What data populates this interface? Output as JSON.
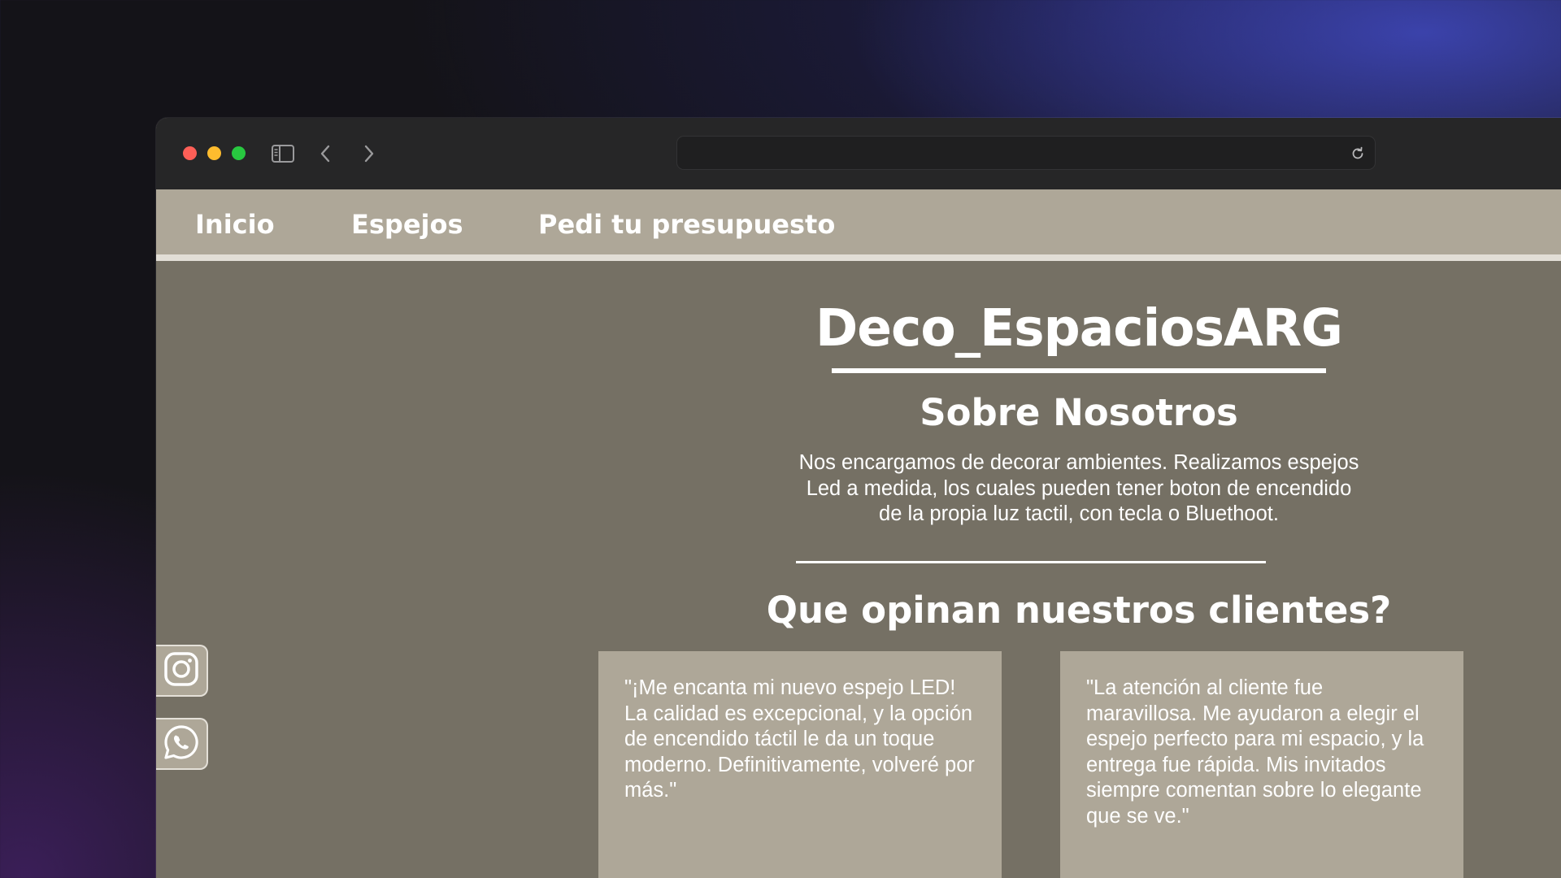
{
  "browser": {
    "url": ""
  },
  "nav": {
    "items": [
      {
        "label": "Inicio"
      },
      {
        "label": "Espejos"
      },
      {
        "label": "Pedi tu presupuesto"
      }
    ]
  },
  "main": {
    "brand": "Deco_EspaciosARG",
    "about_title": "Sobre Nosotros",
    "about_text": "Nos encargamos de decorar ambientes. Realizamos espejos Led a medida, los cuales pueden tener boton de encendido de la propia luz tactil, con tecla o Bluethoot.",
    "reviews_title": "Que opinan nuestros clientes?",
    "reviews": [
      {
        "text": "\"¡Me encanta mi nuevo espejo LED! La calidad es excepcional, y la opción de encendido táctil le da un toque moderno. Definitivamente, volveré por más.\""
      },
      {
        "text": "\"La atención al cliente fue maravillosa. Me ayudaron a elegir el espejo perfecto para mi espacio, y la entrega fue rápida. Mis invitados siempre comentan sobre lo elegante que se ve.\""
      }
    ]
  },
  "social": {
    "items": [
      {
        "icon": "instagram-icon"
      },
      {
        "icon": "whatsapp-icon"
      }
    ]
  },
  "colors": {
    "page_bg": "#757064",
    "nav_bg": "#aea798",
    "card_bg": "#aea798",
    "toolbar_bg": "#262627",
    "accent_text": "#ffffff"
  }
}
